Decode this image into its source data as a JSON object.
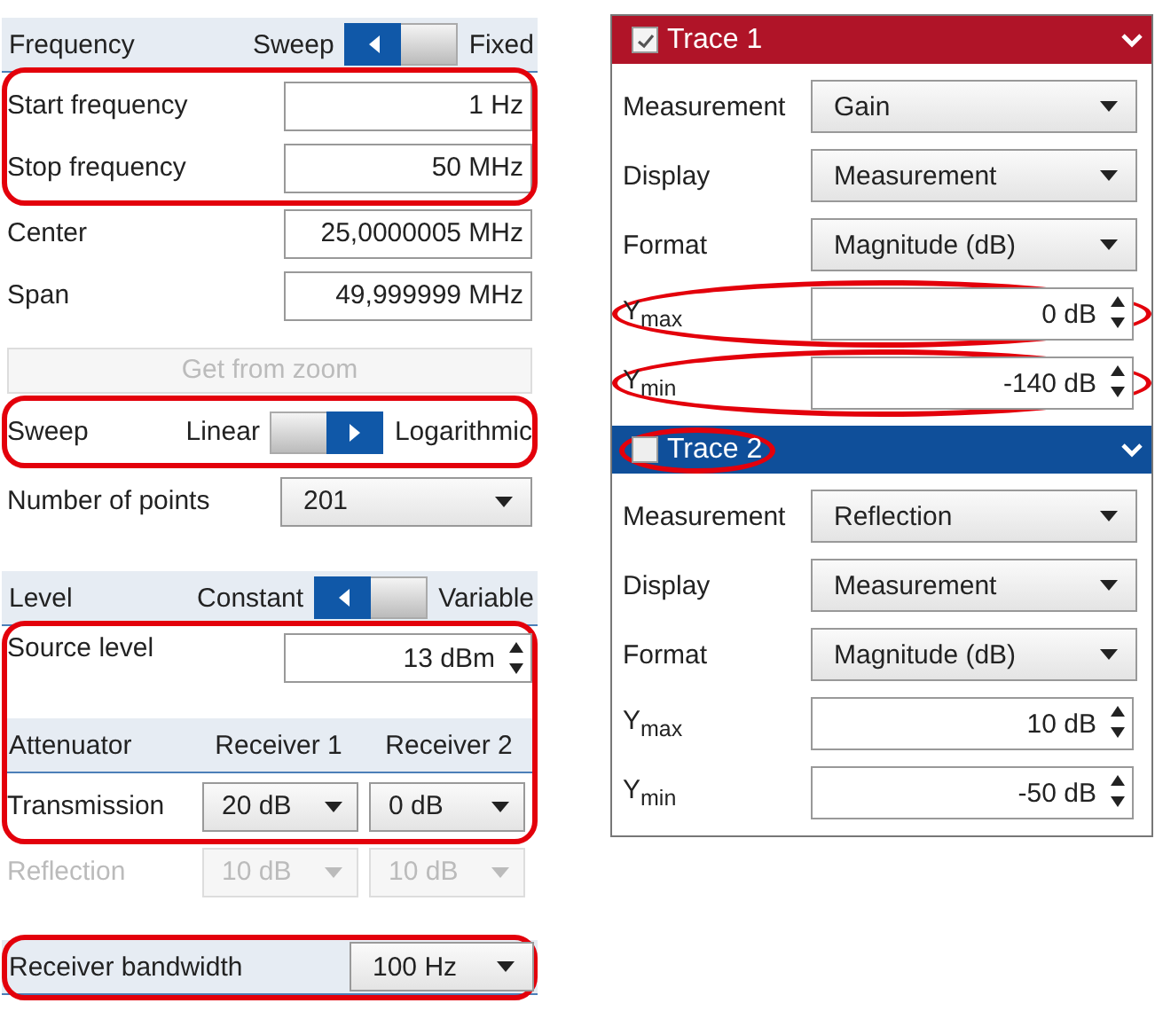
{
  "settings": {
    "blocks": [
      {
        "highlighted": false,
        "rows": [
          {
            "kind": "header",
            "label": "Frequency",
            "options": [
              {
                "label": "Sweep",
                "selected": true
              },
              {
                "label": "Fixed",
                "selected": false
              }
            ]
          }
        ]
      },
      {
        "highlighted": true,
        "rows": [
          {
            "kind": "text",
            "label": "Start frequency",
            "value": "1 Hz"
          },
          {
            "kind": "text",
            "label": "Stop frequency",
            "value": "50 MHz"
          }
        ]
      },
      {
        "highlighted": false,
        "rows": [
          {
            "kind": "text",
            "label": "Center",
            "value": "25,0000005 MHz"
          },
          {
            "kind": "text",
            "label": "Span",
            "value": "49,999999 MHz"
          }
        ]
      },
      {
        "highlighted": false,
        "rows": [
          {
            "kind": "button",
            "label": "Get from zoom",
            "disabled": true
          }
        ]
      },
      {
        "highlighted": true,
        "rows": [
          {
            "kind": "toggle",
            "label": "Sweep",
            "options": [
              {
                "label": "Linear",
                "selected": false
              },
              {
                "label": "Logarithmic",
                "selected": true
              }
            ]
          }
        ]
      },
      {
        "highlighted": false,
        "rows": [
          {
            "kind": "select",
            "label": "Number of points",
            "value": "201"
          }
        ]
      },
      {
        "highlighted": false,
        "rows": [
          {
            "kind": "header",
            "label": "Level",
            "options": [
              {
                "label": "Constant",
                "selected": true
              },
              {
                "label": "Variable",
                "selected": false
              }
            ]
          }
        ]
      },
      {
        "highlighted": true,
        "rows": [
          {
            "kind": "spin",
            "label": "Source level",
            "value": "13 dBm"
          },
          {
            "kind": "columns",
            "labels": [
              "Attenuator",
              "Receiver 1",
              "Receiver 2"
            ]
          },
          {
            "kind": "pair",
            "label": "Transmission",
            "values": [
              "20 dB",
              "0 dB"
            ],
            "disabled": false
          }
        ]
      },
      {
        "highlighted": false,
        "rows": [
          {
            "kind": "pair",
            "label": "Reflection",
            "values": [
              "10 dB",
              "10 dB"
            ],
            "disabled": true
          }
        ]
      },
      {
        "highlighted": true,
        "rows": [
          {
            "kind": "band",
            "label": "Receiver bandwidth",
            "value": "100 Hz"
          }
        ]
      }
    ]
  },
  "traces": [
    {
      "title": "Trace 1",
      "color": "#b01428",
      "checked": true,
      "checkbox_highlighted": false,
      "fields": [
        {
          "kind": "select",
          "label": "Measurement",
          "value": "Gain",
          "highlighted": false
        },
        {
          "kind": "select",
          "label": "Display",
          "value": "Measurement",
          "highlighted": false
        },
        {
          "kind": "select",
          "label": "Format",
          "value": "Magnitude (dB)",
          "highlighted": false
        },
        {
          "kind": "spin",
          "label": "Y$_{max}$",
          "value": "0 dB",
          "highlighted": true
        },
        {
          "kind": "spin",
          "label": "Y$_{min}$",
          "value": "-140 dB",
          "highlighted": true
        }
      ]
    },
    {
      "title": "Trace 2",
      "color": "#0f4f9a",
      "checked": false,
      "checkbox_highlighted": true,
      "fields": [
        {
          "kind": "select",
          "label": "Measurement",
          "value": "Reflection",
          "highlighted": false
        },
        {
          "kind": "select",
          "label": "Display",
          "value": "Measurement",
          "highlighted": false
        },
        {
          "kind": "select",
          "label": "Format",
          "value": "Magnitude (dB)",
          "highlighted": false
        },
        {
          "kind": "spin",
          "label": "Y$_{max}$",
          "value": "10 dB",
          "highlighted": false
        },
        {
          "kind": "spin",
          "label": "Y$_{min}$",
          "value": "-50 dB",
          "highlighted": false
        }
      ]
    }
  ]
}
